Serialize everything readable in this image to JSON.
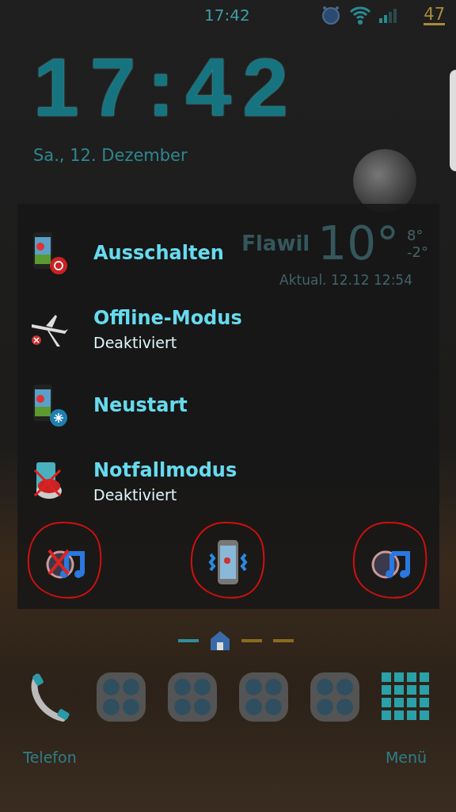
{
  "status_bar": {
    "time": "17:42",
    "battery": "47"
  },
  "clock": {
    "time": "17:42",
    "date": "Sa., 12. Dezember"
  },
  "weather": {
    "city": "Flawil",
    "temperature": "10°",
    "high": "8°",
    "low": "-2°",
    "updated": "Aktual. 12.12 12:54"
  },
  "power_menu": {
    "items": [
      {
        "kind": "power",
        "label": "Ausschalten"
      },
      {
        "kind": "airplane",
        "label": "Offline-Modus",
        "status": "Deaktiviert"
      },
      {
        "kind": "restart",
        "label": "Neustart"
      },
      {
        "kind": "emergency",
        "label": "Notfallmodus",
        "status": "Deaktiviert"
      }
    ],
    "sound_modes": [
      {
        "kind": "mute"
      },
      {
        "kind": "vibrate"
      },
      {
        "kind": "sound"
      }
    ]
  },
  "page_indicator": [
    {
      "kind": "dash",
      "color": "#2f8f99"
    },
    {
      "kind": "home"
    },
    {
      "kind": "dash",
      "color": "#8c6a1e"
    },
    {
      "kind": "dash",
      "color": "#8c6a1e"
    }
  ],
  "dock": [
    {
      "kind": "phone",
      "label": "Telefon"
    },
    {
      "kind": "folder"
    },
    {
      "kind": "folder"
    },
    {
      "kind": "folder"
    },
    {
      "kind": "folder"
    },
    {
      "kind": "apps",
      "label": "Menü"
    }
  ]
}
